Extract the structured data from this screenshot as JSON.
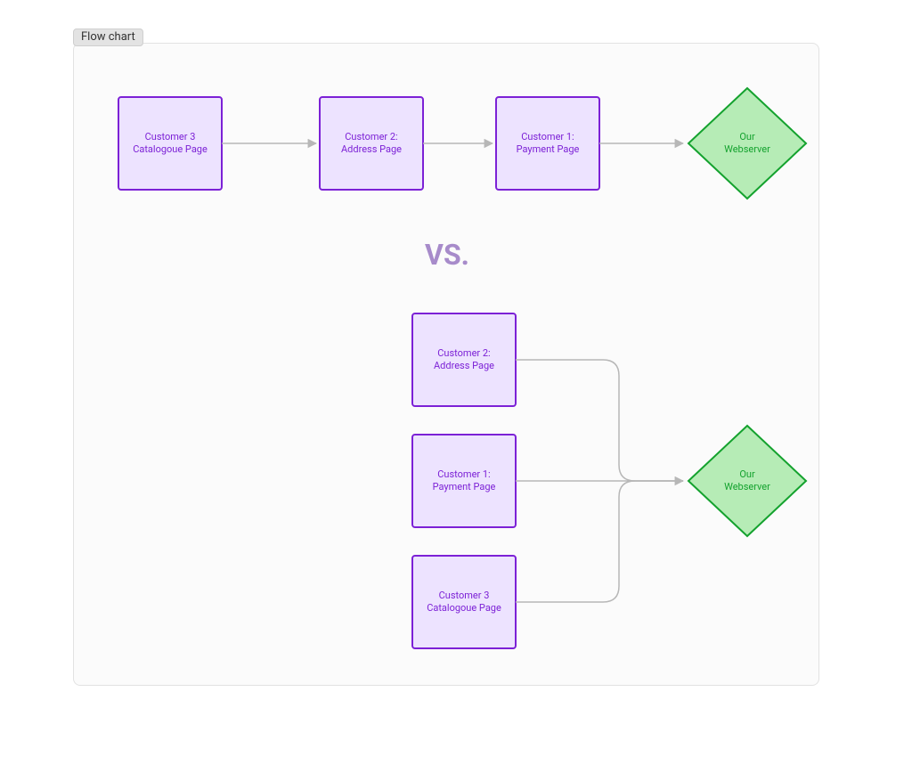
{
  "badge": "Flow chart",
  "vs_label": "VS.",
  "colors": {
    "box_fill": "#ede3ff",
    "box_stroke": "#7c21d6",
    "diamond_fill": "#b6ecb6",
    "diamond_stroke": "#14a22e",
    "edge": "#b7b7b7",
    "vs": "#a78bca"
  },
  "top": {
    "nodes": {
      "a": {
        "line1": "Customer 3",
        "line2": "Catalogoue Page"
      },
      "b": {
        "line1": "Customer 2:",
        "line2": "Address Page"
      },
      "c": {
        "line1": "Customer 1:",
        "line2": "Payment Page"
      },
      "server": {
        "line1": "Our",
        "line2": "Webserver"
      }
    }
  },
  "bottom": {
    "nodes": {
      "a": {
        "line1": "Customer 2:",
        "line2": "Address Page"
      },
      "b": {
        "line1": "Customer 1:",
        "line2": "Payment Page"
      },
      "c": {
        "line1": "Customer 3",
        "line2": "Catalogoue Page"
      },
      "server": {
        "line1": "Our",
        "line2": "Webserver"
      }
    }
  },
  "chart_data": {
    "type": "flowchart",
    "sections": [
      {
        "name": "sequential",
        "nodes": [
          {
            "id": "t1",
            "shape": "rect",
            "label": "Customer 3 Catalogoue Page"
          },
          {
            "id": "t2",
            "shape": "rect",
            "label": "Customer 2: Address Page"
          },
          {
            "id": "t3",
            "shape": "rect",
            "label": "Customer 1: Payment Page"
          },
          {
            "id": "ts",
            "shape": "diamond",
            "label": "Our Webserver"
          }
        ],
        "edges": [
          {
            "from": "t1",
            "to": "t2"
          },
          {
            "from": "t2",
            "to": "t3"
          },
          {
            "from": "t3",
            "to": "ts"
          }
        ]
      },
      {
        "name": "parallel",
        "nodes": [
          {
            "id": "b1",
            "shape": "rect",
            "label": "Customer 2: Address Page"
          },
          {
            "id": "b2",
            "shape": "rect",
            "label": "Customer 1: Payment Page"
          },
          {
            "id": "b3",
            "shape": "rect",
            "label": "Customer 3 Catalogoue Page"
          },
          {
            "id": "bs",
            "shape": "diamond",
            "label": "Our Webserver"
          }
        ],
        "edges": [
          {
            "from": "b1",
            "to": "bs"
          },
          {
            "from": "b2",
            "to": "bs"
          },
          {
            "from": "b3",
            "to": "bs"
          }
        ]
      }
    ],
    "separator_label": "VS."
  }
}
